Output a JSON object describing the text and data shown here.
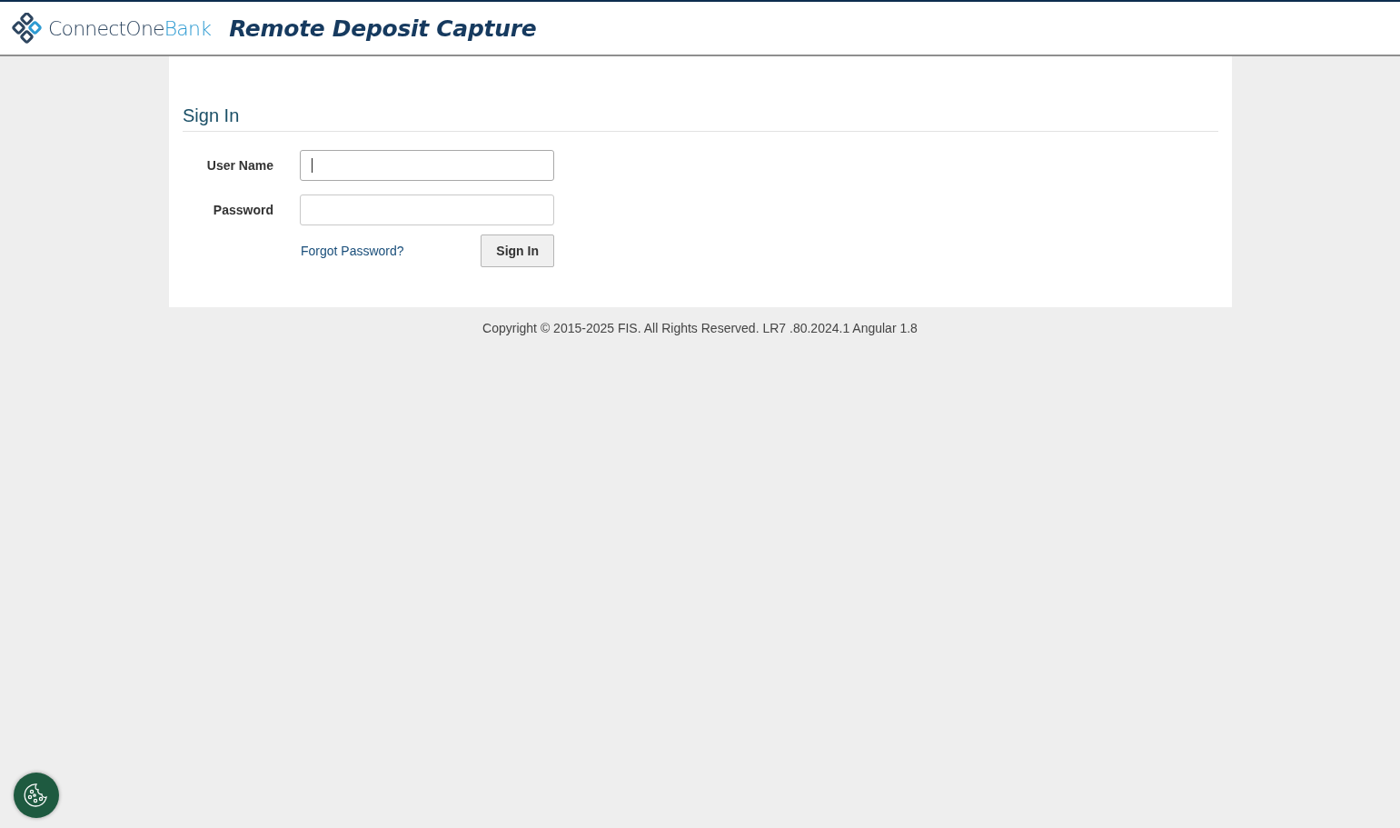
{
  "header": {
    "brand": {
      "primary": "ConnectOne",
      "accent": "Bank"
    },
    "title": "Remote Deposit Capture"
  },
  "sign_in": {
    "heading": "Sign In",
    "fields": [
      {
        "label": "User Name",
        "focused": true
      },
      {
        "label": "Password",
        "focused": false
      }
    ],
    "forgot_link": "Forgot Password?",
    "submit": "Sign In"
  },
  "footer": "Copyright © 2015-2025 FIS. All Rights Reserved. LR7 .80.2024.1 Angular 1.8"
}
